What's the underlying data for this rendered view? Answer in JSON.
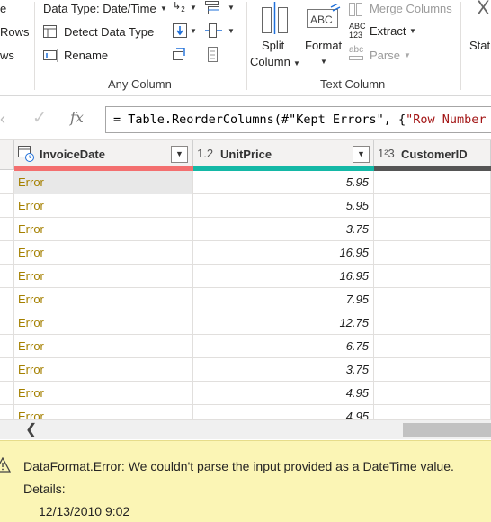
{
  "ribbon": {
    "any_column": {
      "data_type_label": "Data Type: Date/Time",
      "detect_data_type_label": "Detect Data Type",
      "rename_label": "Rename",
      "group_label": "Any Column",
      "partial_labels": [
        "e",
        "Rows",
        "ws"
      ]
    },
    "text_column": {
      "split_column_label": "Split",
      "split_column_label2": "Column",
      "format_label": "Format",
      "merge_columns_label": "Merge Columns",
      "extract_label": "Extract",
      "parse_label": "Parse",
      "group_label": "Text Column",
      "abc_icon_text": "ABC",
      "abc123_line1": "ABC",
      "abc123_line2": "123",
      "abc_small": "abc"
    },
    "statistics": {
      "label_partial": "Stati",
      "icon_partial": "X"
    }
  },
  "formula_bar": {
    "cancel_glyph": "✕",
    "confirm_glyph": "✓",
    "fx_label": "fx",
    "formula_prefix": "= Table.ReorderColumns(#\"Kept Errors\", {",
    "formula_string": "\"Row Number"
  },
  "grid": {
    "columns": [
      {
        "name": "InvoiceDate",
        "type_icon": "datetime-icon",
        "quality_color": "#f36f6f"
      },
      {
        "name": "UnitPrice",
        "type_icon": "1.2",
        "quality_color": "#14b8a6"
      },
      {
        "name": "CustomerID",
        "type_icon": "1²3",
        "quality_color": "#555555"
      }
    ],
    "rows": [
      {
        "invoice_date": "Error",
        "unit_price": "5.95"
      },
      {
        "invoice_date": "Error",
        "unit_price": "5.95"
      },
      {
        "invoice_date": "Error",
        "unit_price": "3.75"
      },
      {
        "invoice_date": "Error",
        "unit_price": "16.95"
      },
      {
        "invoice_date": "Error",
        "unit_price": "16.95"
      },
      {
        "invoice_date": "Error",
        "unit_price": "7.95"
      },
      {
        "invoice_date": "Error",
        "unit_price": "12.75"
      },
      {
        "invoice_date": "Error",
        "unit_price": "6.75"
      },
      {
        "invoice_date": "Error",
        "unit_price": "3.75"
      },
      {
        "invoice_date": "Error",
        "unit_price": "4.95"
      },
      {
        "invoice_date": "Error",
        "unit_price": "4.95"
      }
    ],
    "error_text_color": "#a58000"
  },
  "error_panel": {
    "title": "DataFormat.Error: We couldn't parse the input provided as a DateTime value.",
    "details_label": "Details:",
    "value": "12/13/2010 9:02",
    "background_color": "#fbf5b5"
  }
}
